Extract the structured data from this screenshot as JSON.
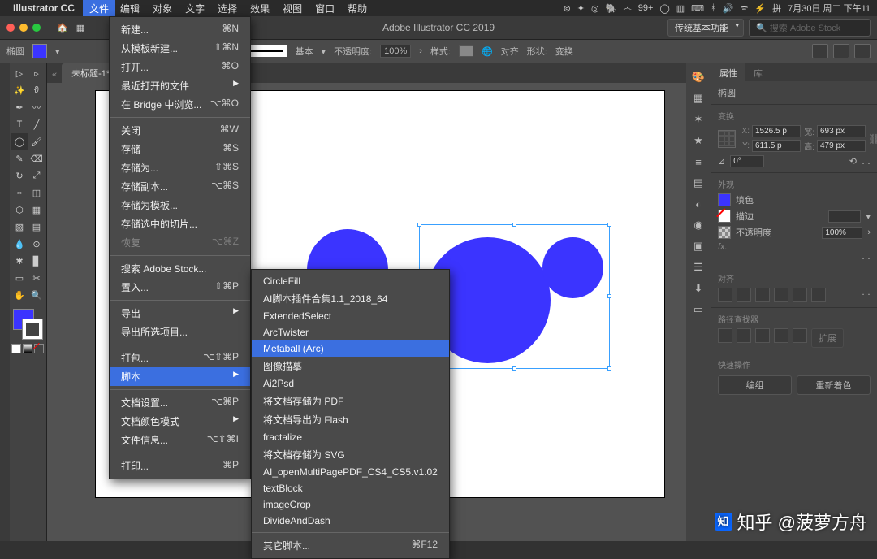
{
  "mac": {
    "app": "Illustrator CC",
    "menus": {
      "file": "文件",
      "edit": "编辑",
      "object": "对象",
      "type": "文字",
      "select": "选择",
      "effect": "效果",
      "view": "视图",
      "window": "窗口",
      "help": "帮助"
    },
    "right": {
      "badge": "99+",
      "date": "7月30日 周二 下午11"
    }
  },
  "window": {
    "title": "Adobe Illustrator CC 2019",
    "workspace": "传统基本功能",
    "search_ph": "搜索 Adobe Stock"
  },
  "optbar": {
    "tool_label": "椭圆",
    "stroke_label": "基本",
    "opacity_label": "不透明度:",
    "opacity_val": "100%",
    "style_label": "样式:",
    "align_label": "对齐",
    "shape_label": "形状:",
    "transform_label": "变换"
  },
  "tab": {
    "name": "未标题-1* @"
  },
  "file_menu": [
    {
      "label": "新建...",
      "sc": "⌘N"
    },
    {
      "label": "从模板新建...",
      "sc": "⇧⌘N"
    },
    {
      "label": "打开...",
      "sc": "⌘O"
    },
    {
      "label": "最近打开的文件",
      "sub": true
    },
    {
      "label": "在 Bridge 中浏览...",
      "sc": "⌥⌘O"
    },
    {
      "sep": true
    },
    {
      "label": "关闭",
      "sc": "⌘W"
    },
    {
      "label": "存储",
      "sc": "⌘S"
    },
    {
      "label": "存储为...",
      "sc": "⇧⌘S"
    },
    {
      "label": "存储副本...",
      "sc": "⌥⌘S"
    },
    {
      "label": "存储为模板..."
    },
    {
      "label": "存储选中的切片..."
    },
    {
      "label": "恢复",
      "sc": "⌥⌘Z",
      "disabled": true
    },
    {
      "sep": true
    },
    {
      "label": "搜索 Adobe Stock..."
    },
    {
      "label": "置入...",
      "sc": "⇧⌘P"
    },
    {
      "sep": true
    },
    {
      "label": "导出",
      "sub": true
    },
    {
      "label": "导出所选项目..."
    },
    {
      "sep": true
    },
    {
      "label": "打包...",
      "sc": "⌥⇧⌘P"
    },
    {
      "label": "脚本",
      "sub": true,
      "hi": true
    },
    {
      "sep": true
    },
    {
      "label": "文档设置...",
      "sc": "⌥⌘P"
    },
    {
      "label": "文档颜色模式",
      "sub": true
    },
    {
      "label": "文件信息...",
      "sc": "⌥⇧⌘I"
    },
    {
      "sep": true
    },
    {
      "label": "打印...",
      "sc": "⌘P"
    }
  ],
  "script_menu": [
    {
      "label": "CircleFill"
    },
    {
      "label": "AI脚本插件合集1.1_2018_64"
    },
    {
      "label": "ExtendedSelect"
    },
    {
      "label": "ArcTwister"
    },
    {
      "label": "Metaball (Arc)",
      "hi": true
    },
    {
      "label": "图像描摹"
    },
    {
      "label": "Ai2Psd"
    },
    {
      "label": "将文档存储为 PDF"
    },
    {
      "label": "将文档导出为 Flash"
    },
    {
      "label": "fractalize"
    },
    {
      "label": "将文档存储为 SVG"
    },
    {
      "label": "AI_openMultiPagePDF_CS4_CS5.v1.02"
    },
    {
      "label": "textBlock"
    },
    {
      "label": "imageCrop"
    },
    {
      "label": "DivideAndDash"
    },
    {
      "sep": true
    },
    {
      "label": "其它脚本...",
      "sc": "⌘F12"
    }
  ],
  "panels": {
    "prop_tab": "属性",
    "lib_tab": "库",
    "obj_label": "椭圆",
    "transform_title": "变换",
    "x_label": "X:",
    "x_val": "1526.5 p",
    "y_label": "Y:",
    "y_val": "611.5 p",
    "w_label": "宽:",
    "w_val": "693 px",
    "h_label": "高:",
    "h_val": "479 px",
    "angle_lab": "⊿",
    "angle_val": "0°",
    "more": "…",
    "appearance_title": "外观",
    "fill_label": "填色",
    "stroke_label": "描边",
    "stroke_weight": "",
    "opacity_label": "不透明度",
    "opacity_val": "100%",
    "fx_label": "fx.",
    "align_title": "对齐",
    "pathfinder_title": "路径查找器",
    "expand_btn": "扩展",
    "quick_title": "快速操作",
    "group_btn": "编组",
    "recolor_btn": "重新着色"
  },
  "watermark": "知乎 @菠萝方舟"
}
